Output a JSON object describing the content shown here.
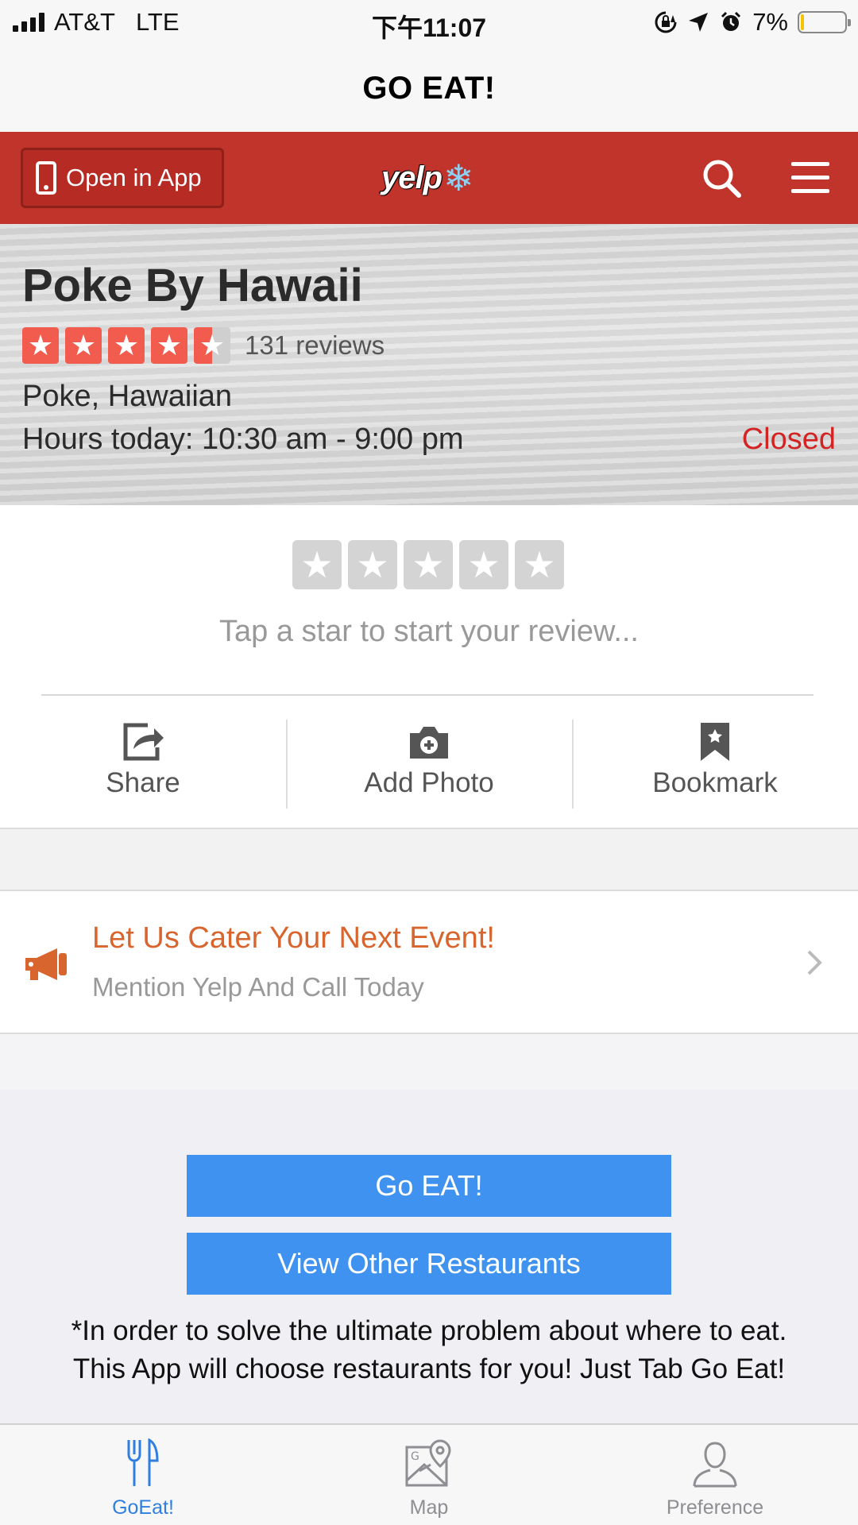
{
  "status_bar": {
    "carrier": "AT&T",
    "network": "LTE",
    "time": "下午11:07",
    "battery": "7%",
    "battery_level": 0.07
  },
  "nav": {
    "title": "GO EAT!"
  },
  "yelp_header": {
    "open_in_app": "Open in App",
    "logo": "yelp",
    "colors": {
      "brand_red": "#c1342c"
    }
  },
  "business": {
    "name": "Poke By Hawaii",
    "rating": 4.5,
    "reviews": "131 reviews",
    "categories": "Poke, Hawaiian",
    "hours": "Hours today: 10:30 am - 9:00 pm",
    "status": "Closed"
  },
  "review": {
    "prompt": "Tap a star to start your review..."
  },
  "actions": [
    {
      "label": "Share",
      "icon": "share-icon"
    },
    {
      "label": "Add Photo",
      "icon": "camera-icon"
    },
    {
      "label": "Bookmark",
      "icon": "bookmark-icon"
    }
  ],
  "promo": {
    "title": "Let Us Cater Your Next Event!",
    "subtitle": "Mention Yelp And Call Today",
    "icon": "megaphone-icon"
  },
  "buttons": {
    "go_eat": "Go EAT!",
    "view_other": "View Other Restaurants",
    "color": "#3f92f0"
  },
  "note": "*In order to solve the ultimate problem about where to eat. This App will choose restaurants for you! Just Tab Go Eat!",
  "tabs": [
    {
      "label": "GoEat!",
      "icon": "fork-knife-icon",
      "active": true
    },
    {
      "label": "Map",
      "icon": "map-icon",
      "active": false
    },
    {
      "label": "Preference",
      "icon": "person-icon",
      "active": false
    }
  ]
}
